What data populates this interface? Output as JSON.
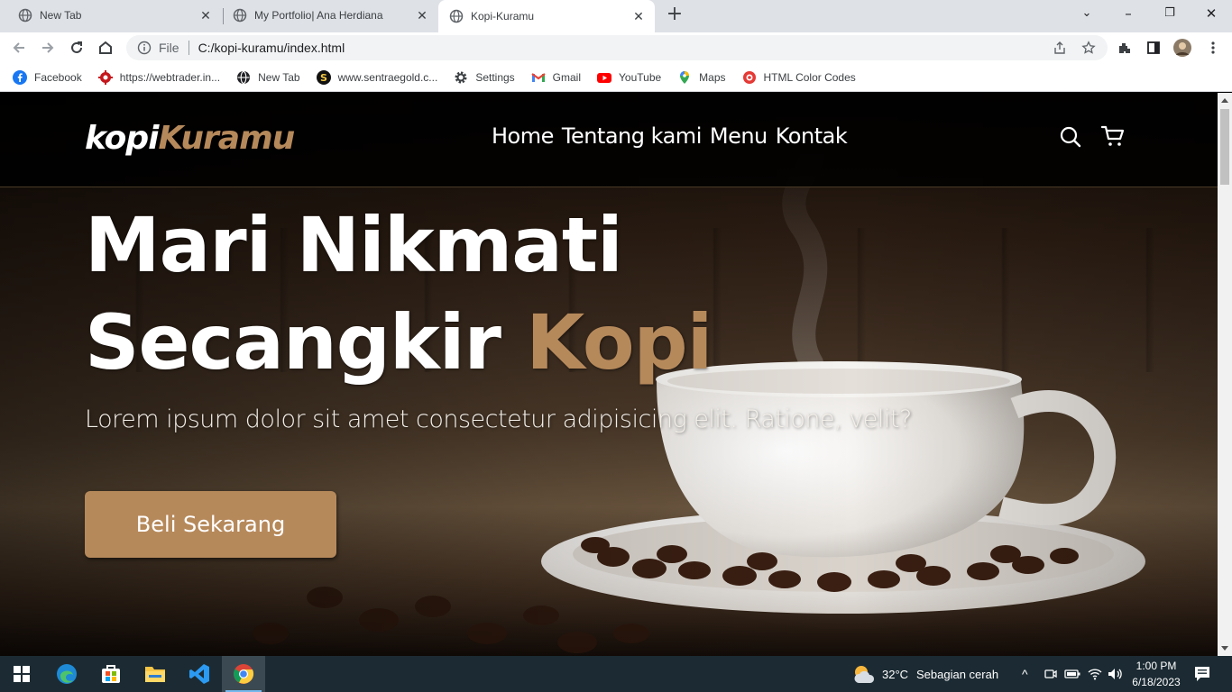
{
  "browser": {
    "tabs": [
      {
        "title": "New Tab",
        "active": false
      },
      {
        "title": "My Portfolio| Ana Herdiana",
        "active": false
      },
      {
        "title": "Kopi-Kuramu",
        "active": true
      }
    ],
    "address": {
      "scheme_label": "File",
      "url": "C:/kopi-kuramu/index.html"
    },
    "bookmarks": [
      {
        "label": "Facebook",
        "icon": "facebook-icon"
      },
      {
        "label": "https://webtrader.in...",
        "icon": "webtrader-icon"
      },
      {
        "label": "New Tab",
        "icon": "globe-icon"
      },
      {
        "label": "www.sentraegold.c...",
        "icon": "sentraegold-icon"
      },
      {
        "label": "Settings",
        "icon": "gear-icon"
      },
      {
        "label": "Gmail",
        "icon": "gmail-icon"
      },
      {
        "label": "YouTube",
        "icon": "youtube-icon"
      },
      {
        "label": "Maps",
        "icon": "maps-icon"
      },
      {
        "label": "HTML Color Codes",
        "icon": "html-color-codes-icon"
      }
    ]
  },
  "page": {
    "logo": {
      "part1": "kopi",
      "part2": "Kuramu"
    },
    "nav": [
      "Home",
      "Tentang kami",
      "Menu",
      "Kontak"
    ],
    "hero": {
      "title_line1": "Mari Nikmati",
      "title_line2_plain": "Secangkir",
      "title_line2_accent": "Kopi",
      "subtitle": "Lorem ipsum dolor sit amet consectetur adipisicing elit. Ratione, velit?",
      "cta": "Beli Sekarang"
    },
    "colors": {
      "accent": "#b6895b",
      "navbar_bg": "#000000"
    }
  },
  "taskbar": {
    "weather": {
      "temp": "32°C",
      "desc": "Sebagian cerah"
    },
    "time": "1:00 PM",
    "date": "6/18/2023"
  }
}
